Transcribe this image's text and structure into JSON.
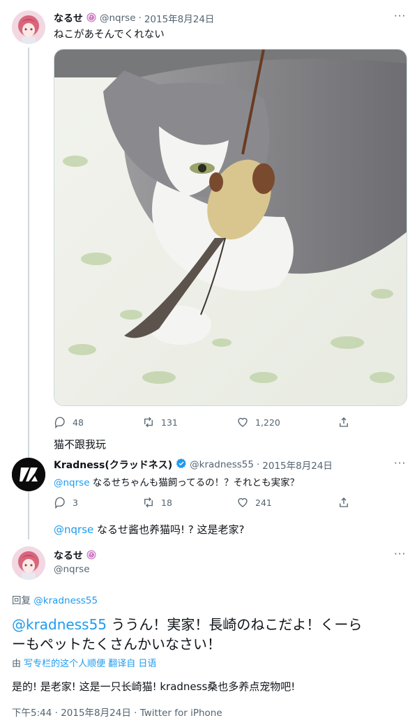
{
  "tweet1": {
    "name": "なるせ",
    "handle": "@nqrse",
    "date": "2015年8月24日",
    "text": "ねこがあそんでくれない",
    "more": "···",
    "actions": {
      "replies": "48",
      "retweets": "131",
      "likes": "1,220"
    }
  },
  "translation1": "猫不跟我玩",
  "tweet2": {
    "name": "Kradness(クラッドネス)",
    "handle": "@kradness55",
    "date": "2015年8月24日",
    "mention": "@nqrse",
    "text": " なるせちゃんも猫飼ってるの！？それとも実家？",
    "more": "···",
    "actions": {
      "replies": "3",
      "retweets": "18",
      "likes": "241"
    }
  },
  "translation2": {
    "mention": "@nqrse",
    "text": " なるせ酱也养猫吗! ? 这是老家?"
  },
  "tweet3": {
    "name": "なるせ",
    "handle": "@nqrse",
    "more": "···",
    "reply_to_label": "回复 ",
    "reply_to_handle": "@kradness55",
    "mention": "@kradness55",
    "text_line1": " ううん！実家！長崎のねこだよ！くーら",
    "text_line2": "ーもペットたくさんかいなさい！",
    "translate_prefix": "由 ",
    "translate_source": "写专栏的这个人顺便",
    "translate_suffix": " 翻译自 日语",
    "translated_text": "是的! 是老家! 这是一只长崎猫! kradness桑也多养点宠物吧!",
    "meta_time": "下午5:44 · 2015年8月24日 · ",
    "meta_client": "Twitter for iPhone"
  },
  "colors": {
    "link": "#1d9bf0",
    "muted": "#536471",
    "line": "#cfd9de"
  }
}
